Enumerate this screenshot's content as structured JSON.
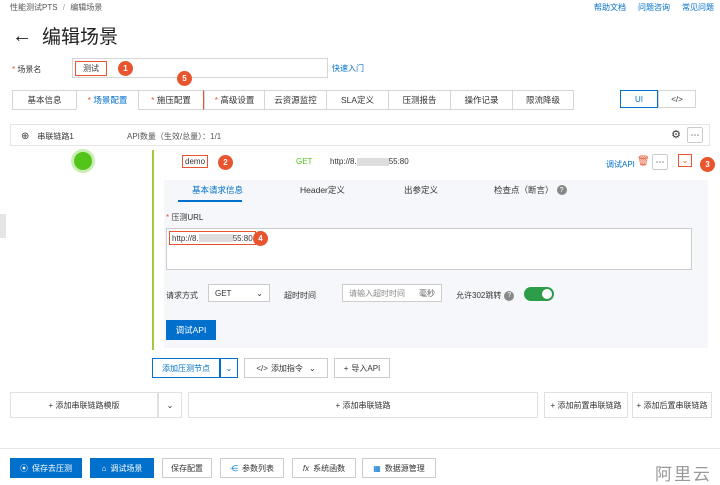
{
  "breadcrumb": {
    "items": [
      "性能测试PTS",
      "编辑场景"
    ],
    "separator": "/"
  },
  "help_links": [
    "帮助文档",
    "问题咨询",
    "常见问题"
  ],
  "page": {
    "title": "编辑场景"
  },
  "scene": {
    "label": "场景名",
    "value": "测试",
    "quick_link": "快速入门"
  },
  "tabs": [
    {
      "label": "基本信息",
      "required": false
    },
    {
      "label": "场景配置",
      "required": true
    },
    {
      "label": "施压配置",
      "required": true
    },
    {
      "label": "高级设置",
      "required": true
    },
    {
      "label": "云资源监控",
      "required": false
    },
    {
      "label": "SLA定义",
      "required": false
    },
    {
      "label": "压测报告",
      "required": false
    },
    {
      "label": "操作记录",
      "required": false
    },
    {
      "label": "限流降级",
      "required": false
    }
  ],
  "view_toggle": {
    "ui": "UI",
    "code": "</>"
  },
  "markers": [
    "1",
    "2",
    "3",
    "4",
    "5"
  ],
  "chain": {
    "label": "串联链路1",
    "api_count_label": "API数量（生效/总量）：1/1"
  },
  "api": {
    "name": "demo",
    "method": "GET",
    "url_prefix": "http://8.",
    "url_suffix": "55:80",
    "debug_link": "调试API",
    "sub_tabs": [
      "基本请求信息",
      "Header定义",
      "出参定义",
      "检查点（断言）"
    ],
    "url_field_label": "压测URL",
    "url_value_prefix": "http://8.",
    "url_value_suffix": "55:80",
    "method_label": "请求方式",
    "method_value": "GET",
    "timeout_label": "超时时间",
    "timeout_placeholder": "请输入超时时间",
    "timeout_unit": "毫秒",
    "redirect_label": "允许302跳转",
    "redirect_enabled": true,
    "debug_button": "调试API"
  },
  "node_actions": {
    "add_node": "添加压测节点",
    "add_instruction": "添加指令",
    "import_api": "导入API"
  },
  "chain_actions": {
    "add_template": "添加串联链路模版",
    "add_chain": "添加串联链路",
    "add_pre": "添加前置串联链路",
    "add_post": "添加后置串联链路"
  },
  "footer": {
    "save_start": "保存去压测",
    "debug_scene": "调试场景",
    "save_config": "保存配置",
    "param_list": "参数列表",
    "system_func": "系统函数",
    "data_source": "数据源管理"
  },
  "watermark": "阿里云",
  "colors": {
    "accent": "#0070cc",
    "marker": "#e8542e",
    "success": "#52c41a",
    "toggle": "#2e9d4a"
  }
}
